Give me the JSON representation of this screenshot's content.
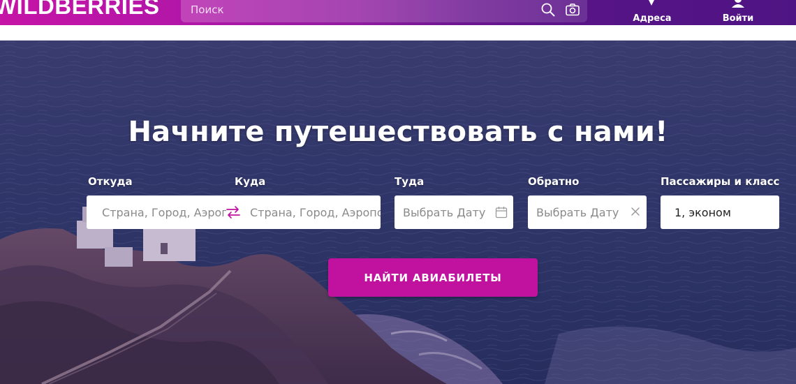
{
  "header": {
    "logo": "WILDBERRIES",
    "search_placeholder": "Поиск",
    "address_label": "Адреса",
    "login_label": "Войти"
  },
  "hero": {
    "title": "Начните путешествовать с нами!"
  },
  "form": {
    "from": {
      "label": "Откуда",
      "placeholder": "Страна, Город, Аэропорт"
    },
    "to": {
      "label": "Куда",
      "placeholder": "Страна, Город, Аэропорт"
    },
    "depart": {
      "label": "Туда",
      "placeholder": "Выбрать Дату"
    },
    "return": {
      "label": "Обратно",
      "placeholder": "Выбрать Дату"
    },
    "passengers": {
      "label": "Пассажиры и класс",
      "value": "1, эконом"
    },
    "submit_label": "НАЙТИ АВИАБИЛЕТЫ"
  },
  "colors": {
    "brand_magenta": "#c514a6",
    "brand_purple": "#4f1483",
    "button": "#c0129f"
  },
  "icons": [
    "search-icon",
    "camera-icon",
    "map-pin-icon",
    "user-icon",
    "swap-arrows-icon",
    "calendar-icon",
    "close-icon"
  ]
}
